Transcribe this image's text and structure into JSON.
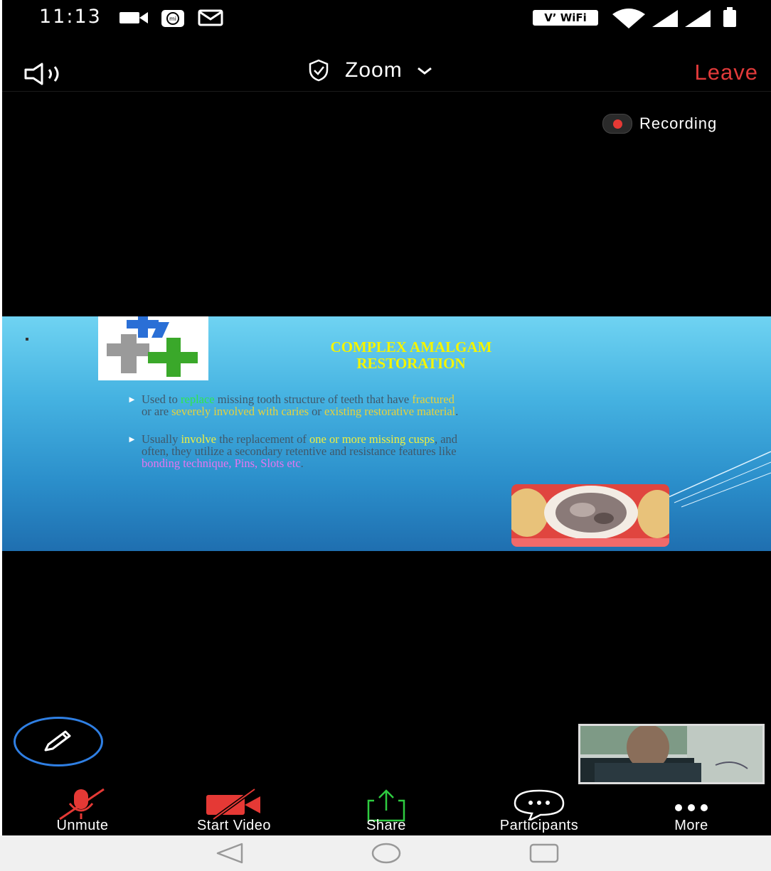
{
  "status_bar": {
    "time": "11:13",
    "wifi_label": "V’ WiFi",
    "icons": [
      "video-camera-icon",
      "mi-icon",
      "gmail-icon",
      "wifi-icon",
      "signal-icon",
      "signal-icon",
      "battery-icon"
    ]
  },
  "header": {
    "app_name": "Zoom",
    "leave_label": "Leave",
    "icons": [
      "speaker-icon",
      "shield-check-icon",
      "chevron-down-icon"
    ]
  },
  "recording": {
    "label": "Recording"
  },
  "slide": {
    "title_line1": "COMPLEX AMALGAM",
    "title_line2": "RESTORATION",
    "bullet1": {
      "p1": "Used to ",
      "h1": "replace",
      "p2": " missing tooth structure of teeth that have ",
      "h2": "fractured",
      "p3": "or are ",
      "h3": "severely involved with caries",
      "p4": " or ",
      "h4": "existing restorative material",
      "p5": "."
    },
    "bullet2": {
      "p1": "Usually ",
      "h1": "involve",
      "p2": " the replacement of ",
      "h2": "one or more missing cusps",
      "p3": ", and",
      "p4": "often, they utilize a secondary retentive and resistance features like",
      "h3": "bonding technique, Pins, Slots etc",
      "p5": "."
    }
  },
  "toolbar": {
    "unmute_label": "Unmute",
    "start_video_label": "Start Video",
    "share_label": "Share",
    "participants_label": "Participants",
    "more_label": "More"
  },
  "colors": {
    "leave": "#e23a3a",
    "muted_red": "#e53935",
    "share_green": "#2ecc40",
    "pencil_ring": "#2f7fe3"
  }
}
